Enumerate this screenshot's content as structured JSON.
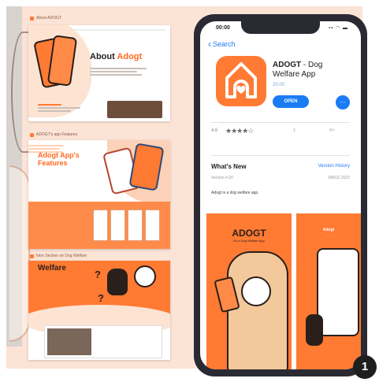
{
  "slides": {
    "about": {
      "label": "About ADOGT",
      "title_prefix": "About",
      "title_accent": "Adogt"
    },
    "features": {
      "label": "ADOGT's app Features",
      "title": "Adogt App's Features"
    },
    "welfare": {
      "label": "Intro Section on Dog Welfare",
      "title": "Welfare",
      "question_mark": "?"
    }
  },
  "phone": {
    "status_time": "00:00",
    "status_icons": "▪▪ ◠ ▬",
    "back_label": "Search",
    "app": {
      "name_bold": "ADOGT",
      "name_rest": " - Dog Welfare App",
      "price": "20.00",
      "open_label": "OPEN",
      "share_label": "…"
    },
    "rating": {
      "value": "4.6",
      "stars": "★★★★☆",
      "col2": "1",
      "col3": "4+"
    },
    "whats_new": {
      "heading": "What's New",
      "history_link": "Version History",
      "version": "Version 4.20",
      "date": "SINCE 2022",
      "description": "Adogt is a dog welfare app."
    },
    "screenshots": {
      "first": {
        "brand": "ADOGT",
        "tagline": "It's a Dog Welfare App"
      },
      "second": {
        "brand": "Adogt",
        "sub": "............"
      }
    }
  },
  "badge": "1",
  "colors": {
    "accent": "#ff7a33",
    "link": "#1a7cf5",
    "background": "#fbe3d6"
  }
}
